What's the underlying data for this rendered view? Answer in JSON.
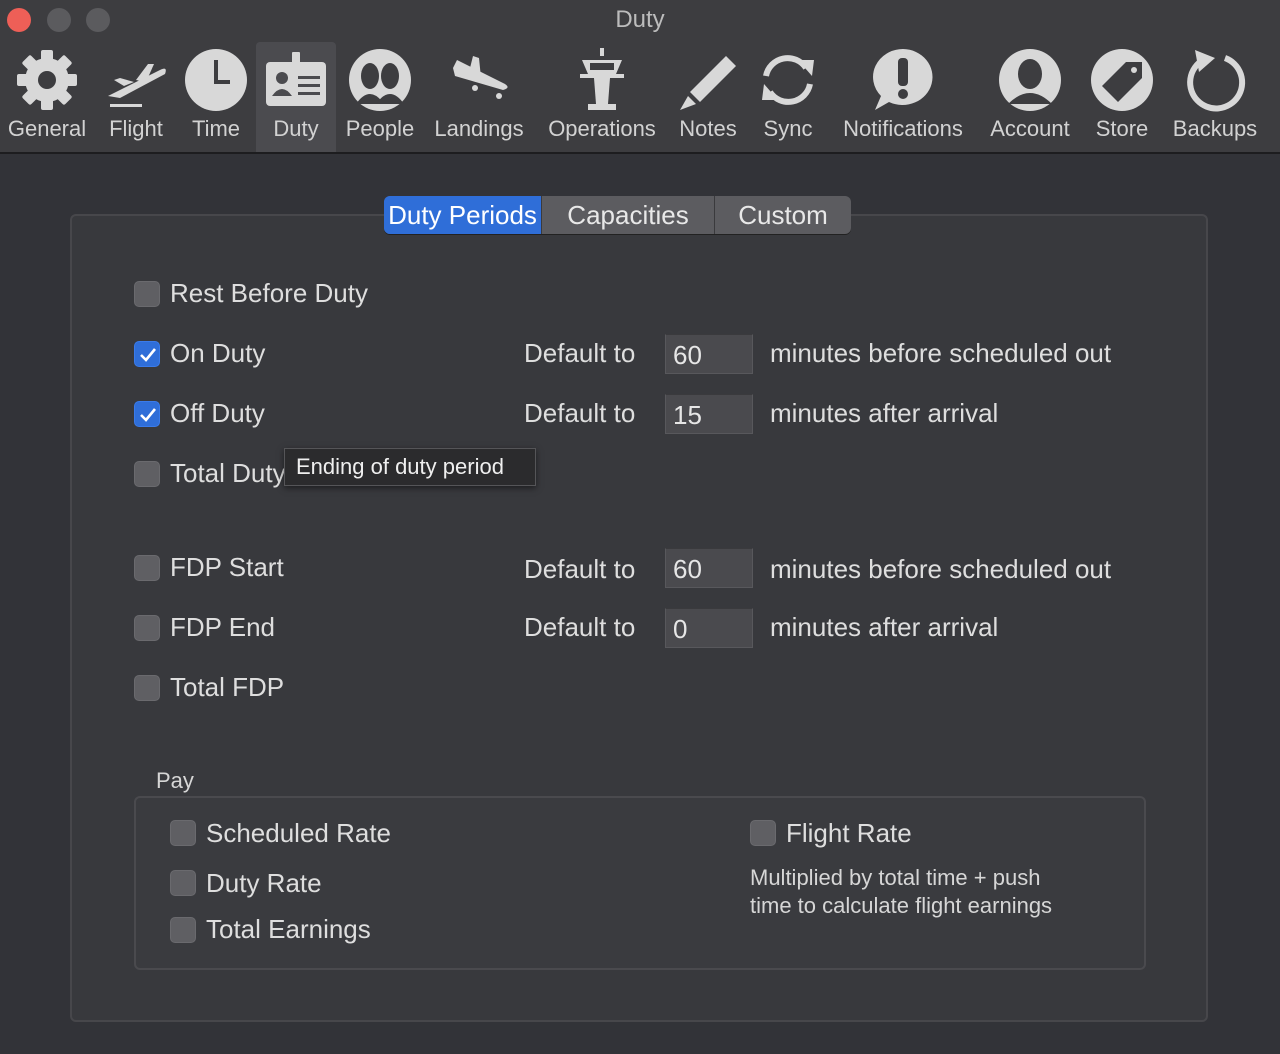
{
  "window": {
    "title": "Duty"
  },
  "toolbar": {
    "items": [
      {
        "label": "General",
        "icon": "gear-icon"
      },
      {
        "label": "Flight",
        "icon": "airplane-icon"
      },
      {
        "label": "Time",
        "icon": "clock-icon"
      },
      {
        "label": "Duty",
        "icon": "id-badge-icon",
        "selected": true
      },
      {
        "label": "People",
        "icon": "people-icon"
      },
      {
        "label": "Landings",
        "icon": "landing-plane-icon"
      },
      {
        "label": "Operations",
        "icon": "control-tower-icon"
      },
      {
        "label": "Notes",
        "icon": "pencil-icon"
      },
      {
        "label": "Sync",
        "icon": "sync-icon"
      },
      {
        "label": "Notifications",
        "icon": "exclamation-bubble-icon"
      },
      {
        "label": "Account",
        "icon": "person-silhouette-icon"
      },
      {
        "label": "Store",
        "icon": "tag-icon"
      },
      {
        "label": "Backups",
        "icon": "circular-arrow-icon"
      }
    ]
  },
  "tabs": [
    {
      "label": "Duty Periods",
      "active": true
    },
    {
      "label": "Capacities",
      "active": false
    },
    {
      "label": "Custom",
      "active": false
    }
  ],
  "duty": {
    "rest_before_duty": {
      "label": "Rest Before Duty",
      "checked": false
    },
    "on_duty": {
      "label": "On Duty",
      "checked": true,
      "default_label": "Default to",
      "value": "60",
      "unit": "minutes before scheduled out"
    },
    "off_duty": {
      "label": "Off Duty",
      "checked": true,
      "default_label": "Default to",
      "value": "15",
      "unit": "minutes after arrival"
    },
    "total_duty": {
      "label": "Total Duty",
      "checked": false
    },
    "fdp_start": {
      "label": "FDP Start",
      "checked": false,
      "default_label": "Default to",
      "value": "60",
      "unit": "minutes before scheduled out"
    },
    "fdp_end": {
      "label": "FDP End",
      "checked": false,
      "default_label": "Default to",
      "value": "0",
      "unit": "minutes after arrival"
    },
    "total_fdp": {
      "label": "Total FDP",
      "checked": false
    }
  },
  "tooltip": {
    "text": "Ending of duty period"
  },
  "pay": {
    "title": "Pay",
    "scheduled_rate": {
      "label": "Scheduled Rate",
      "checked": false
    },
    "duty_rate": {
      "label": "Duty Rate",
      "checked": false
    },
    "total_earnings": {
      "label": "Total Earnings",
      "checked": false
    },
    "flight_rate": {
      "label": "Flight Rate",
      "checked": false
    },
    "note_line1": "Multiplied by total time + push",
    "note_line2": "time to calculate flight earnings"
  },
  "colors": {
    "accent": "#2f6ed8",
    "background": "#323338",
    "close": "#ee5f57"
  }
}
